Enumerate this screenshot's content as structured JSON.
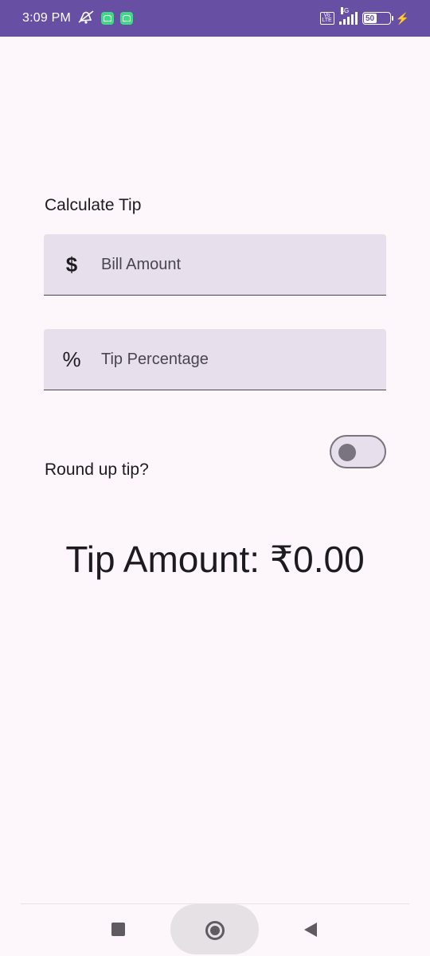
{
  "status_bar": {
    "time": "3:09 PM",
    "network": "4G",
    "volte": "Vo LTE",
    "battery": "50",
    "battery_level": 0.5
  },
  "main": {
    "heading": "Calculate Tip",
    "bill_field": {
      "icon": "$",
      "label": "Bill Amount"
    },
    "tip_field": {
      "icon": "%",
      "label": "Tip Percentage"
    },
    "round_up": {
      "label": "Round up tip?",
      "checked": false
    },
    "tip_amount": "Tip Amount: ₹0.00"
  },
  "icons": {
    "bill": "dollar-icon",
    "tip": "percent-icon",
    "nav": [
      "recents-icon",
      "home-icon",
      "back-icon"
    ]
  },
  "colors": {
    "status_bar": "#6750a4",
    "background": "#fdf7fb",
    "field": "#e7e0ec"
  }
}
